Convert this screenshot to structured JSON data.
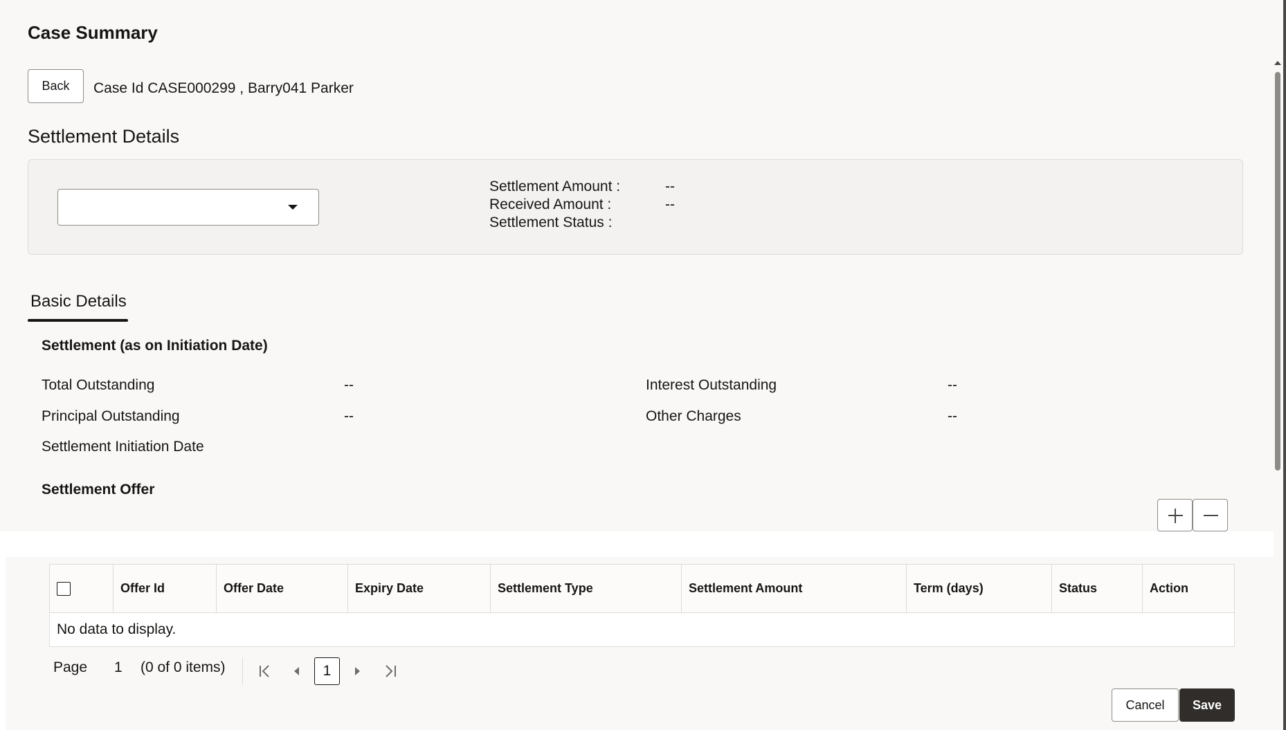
{
  "page": {
    "title": "Case Summary"
  },
  "header": {
    "back_label": "Back",
    "case_info": "Case Id CASE000299 , Barry041 Parker"
  },
  "settlement_details": {
    "title": "Settlement Details",
    "select_value": "",
    "rows": [
      {
        "label": "Settlement Amount :",
        "value": "--"
      },
      {
        "label": "Received Amount :",
        "value": "--"
      },
      {
        "label": "Settlement Status :",
        "value": ""
      }
    ]
  },
  "tabs": [
    {
      "label": "Basic Details",
      "selected": true
    }
  ],
  "basic_details": {
    "section_title": "Settlement (as on Initiation Date)",
    "fields": {
      "total_outstanding": {
        "label": "Total Outstanding",
        "value": "--"
      },
      "interest_outstanding": {
        "label": "Interest Outstanding",
        "value": "--"
      },
      "principal_outstanding": {
        "label": "Principal Outstanding",
        "value": "--"
      },
      "other_charges": {
        "label": "Other Charges",
        "value": "--"
      },
      "settlement_initiation_date": {
        "label": "Settlement Initiation Date",
        "value": ""
      }
    },
    "offer_title": "Settlement Offer"
  },
  "offer_table": {
    "columns": [
      "Offer Id",
      "Offer Date",
      "Expiry Date",
      "Settlement Type",
      "Settlement Amount",
      "Term (days)",
      "Status",
      "Action"
    ],
    "empty_text": "No data to display."
  },
  "pagination": {
    "page_label": "Page",
    "page_value": "1",
    "items_text": "(0 of 0 items)",
    "current_page": "1"
  },
  "footer": {
    "cancel_label": "Cancel",
    "save_label": "Save"
  },
  "icons": {
    "add": "plus-icon",
    "remove": "minus-icon",
    "dropdown": "caret-down-icon",
    "first": "first-page-icon",
    "prev": "previous-page-icon",
    "next": "next-page-icon",
    "last": "last-page-icon"
  },
  "colors": {
    "primary_button": "#312d2a",
    "background": "#f9f8f6",
    "border": "#dddbd8"
  }
}
